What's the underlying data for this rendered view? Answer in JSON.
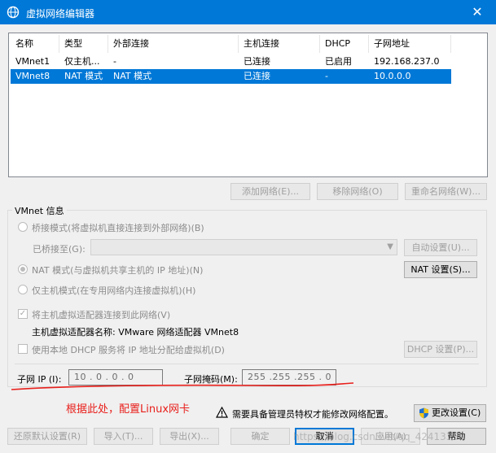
{
  "window": {
    "title": "虚拟网络编辑器",
    "close_glyph": "✕"
  },
  "table": {
    "columns": [
      "名称",
      "类型",
      "外部连接",
      "主机连接",
      "DHCP",
      "子网地址"
    ],
    "rows": [
      {
        "name": "VMnet1",
        "type": "仅主机...",
        "external": "-",
        "host": "已连接",
        "dhcp": "已启用",
        "subnet": "192.168.237.0",
        "selected": false
      },
      {
        "name": "VMnet8",
        "type": "NAT 模式",
        "external": "NAT 模式",
        "host": "已连接",
        "dhcp": "-",
        "subnet": "10.0.0.0",
        "selected": true
      }
    ]
  },
  "list_buttons": {
    "add": "添加网络(E)...",
    "remove": "移除网络(O)",
    "rename": "重命名网络(W)..."
  },
  "vmnet_info": {
    "label": "VMnet 信息",
    "bridge_mode": "桥接模式(将虚拟机直接连接到外部网络)(B)",
    "bridged_to_label": "已桥接至(G):",
    "auto_settings": "自动设置(U)...",
    "nat_mode": "NAT 模式(与虚拟机共享主机的 IP 地址)(N)",
    "nat_settings": "NAT 设置(S)...",
    "host_only_mode": "仅主机模式(在专用网络内连接虚拟机)(H)",
    "connect_adapter": "将主机虚拟适配器连接到此网络(V)",
    "adapter_name": "主机虚拟适配器名称: VMware 网络适配器 VMnet8",
    "use_dhcp": "使用本地 DHCP 服务将 IP 地址分配给虚拟机(D)",
    "dhcp_settings": "DHCP 设置(P)...",
    "subnet_ip_label": "子网 IP (I):",
    "subnet_ip_value": "10 . 0 . 0 . 0",
    "subnet_mask_label": "子网掩码(M):",
    "subnet_mask_value": "255 .255 .255 . 0"
  },
  "annotation": {
    "text": "根据此处，配置Linux网卡",
    "color": "#e8201c"
  },
  "admin_notice": {
    "text": "需要具备管理员特权才能修改网络配置。",
    "change_settings": "更改设置(C)"
  },
  "bottom_buttons": {
    "restore_defaults": "还原默认设置(R)",
    "import": "导入(T)...",
    "export": "导出(X)...",
    "ok": "确定",
    "cancel": "取消",
    "apply": "应用(A)",
    "help": "帮助"
  },
  "watermark": "https://blog.csdn.net/qq_42413359",
  "colors": {
    "accent": "#0078d7",
    "annotation": "#e8201c"
  },
  "icons": {
    "app": "network-globe-icon",
    "warning": "warning-icon",
    "shield": "uac-shield-icon"
  }
}
